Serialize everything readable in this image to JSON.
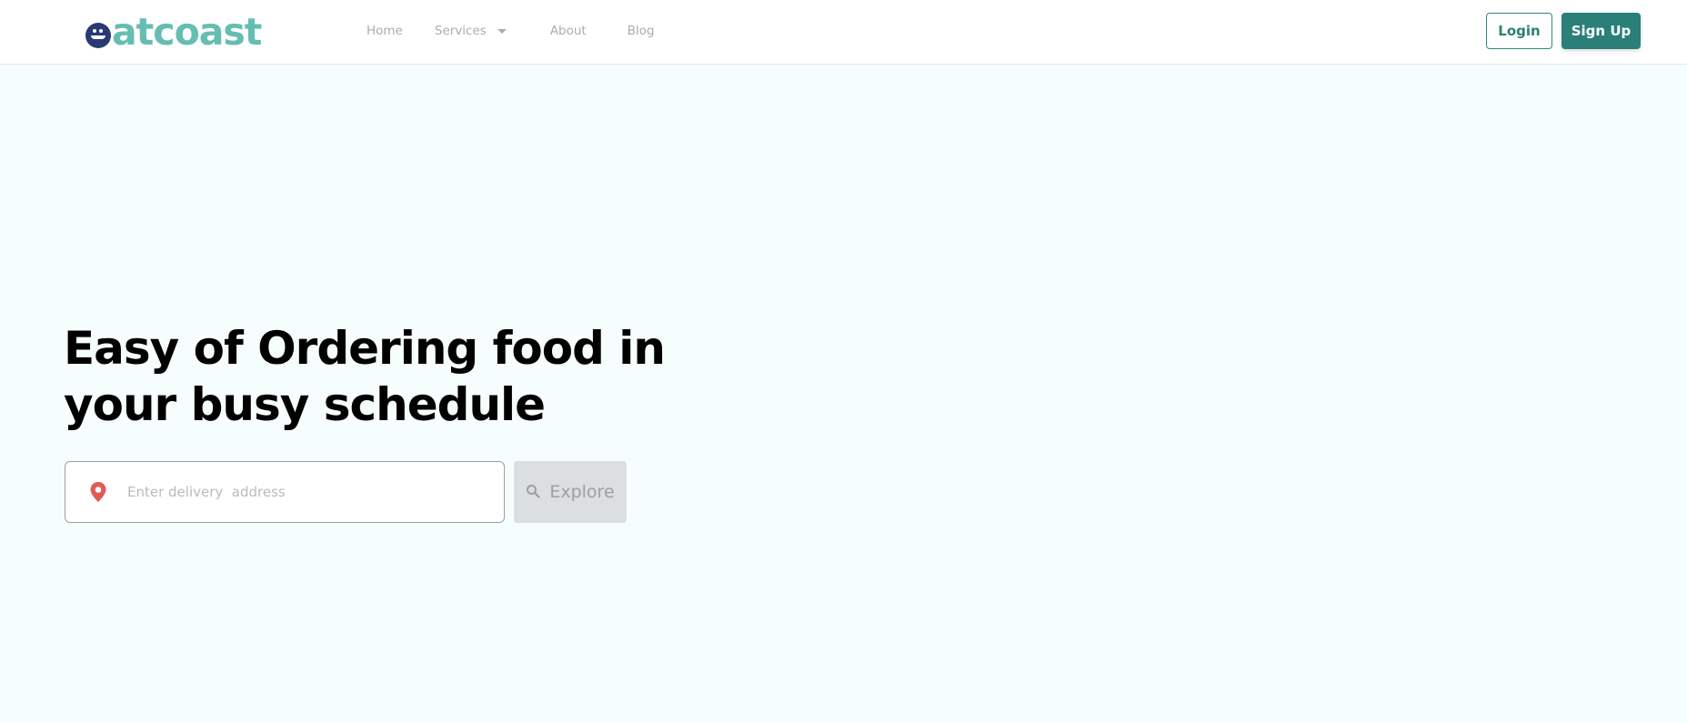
{
  "header": {
    "logo_text": "atcoast",
    "nav": {
      "home": "Home",
      "services": "Services",
      "about": "About",
      "blog": "Blog"
    },
    "login_label": "Login",
    "signup_label": "Sign Up"
  },
  "hero": {
    "title_line1": "Easy of Ordering food in",
    "title_line2": "your busy schedule",
    "address_placeholder": "Enter delivery  address",
    "explore_label": "Explore"
  },
  "icons": {
    "pin": "location-pin-icon",
    "search": "search-icon",
    "caret": "chevron-down-icon"
  },
  "colors": {
    "brand_teal": "#66bdb1",
    "brand_navy": "#273a73",
    "signup_bg": "#2a7f78",
    "pin_red": "#e05a56",
    "page_bg": "#f6fefd"
  }
}
